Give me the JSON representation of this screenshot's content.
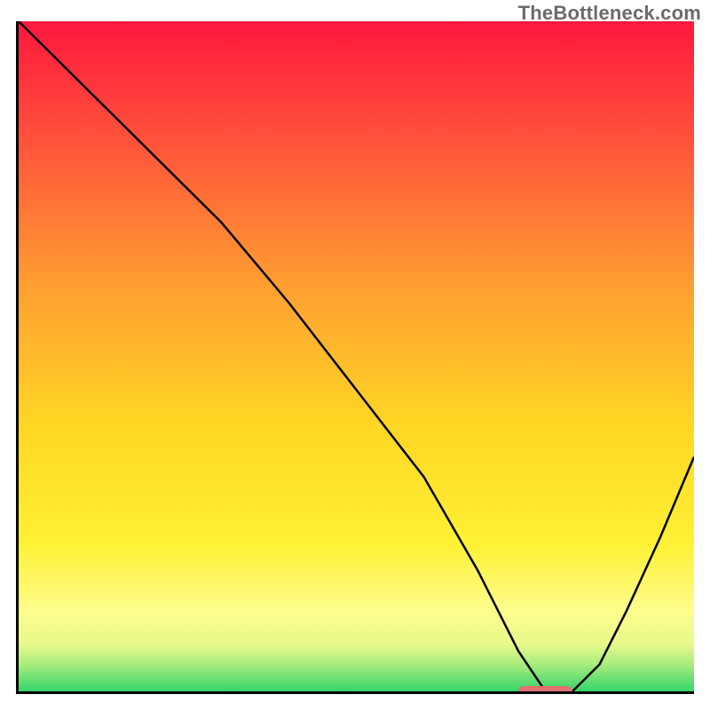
{
  "watermark": "TheBottleneck.com",
  "chart_data": {
    "type": "line",
    "title": "",
    "xlabel": "",
    "ylabel": "",
    "xlim": [
      0,
      100
    ],
    "ylim": [
      0,
      100
    ],
    "grid": false,
    "legend": false,
    "gradient_stops": [
      {
        "pos": 0,
        "color": "#ff173e"
      },
      {
        "pos": 20,
        "color": "#ff5a3a"
      },
      {
        "pos": 40,
        "color": "#ffa031"
      },
      {
        "pos": 60,
        "color": "#ffd624"
      },
      {
        "pos": 78,
        "color": "#fff135"
      },
      {
        "pos": 88,
        "color": "#fdfd8d"
      },
      {
        "pos": 93,
        "color": "#e7f98a"
      },
      {
        "pos": 96,
        "color": "#a7ec7d"
      },
      {
        "pos": 100,
        "color": "#37d56b"
      }
    ],
    "series": [
      {
        "name": "bottleneck-curve",
        "x": [
          0,
          10,
          22,
          30,
          40,
          50,
          60,
          68,
          74,
          78,
          82,
          86,
          90,
          95,
          100
        ],
        "y": [
          100,
          90,
          78,
          70,
          58,
          45,
          32,
          18,
          6,
          0,
          0,
          4,
          12,
          23,
          35
        ]
      }
    ],
    "optimal_marker": {
      "x_start": 74,
      "x_end": 82,
      "y": 0
    },
    "colors": {
      "curve": "#000000",
      "axis": "#000000",
      "marker": "#e17070"
    }
  }
}
